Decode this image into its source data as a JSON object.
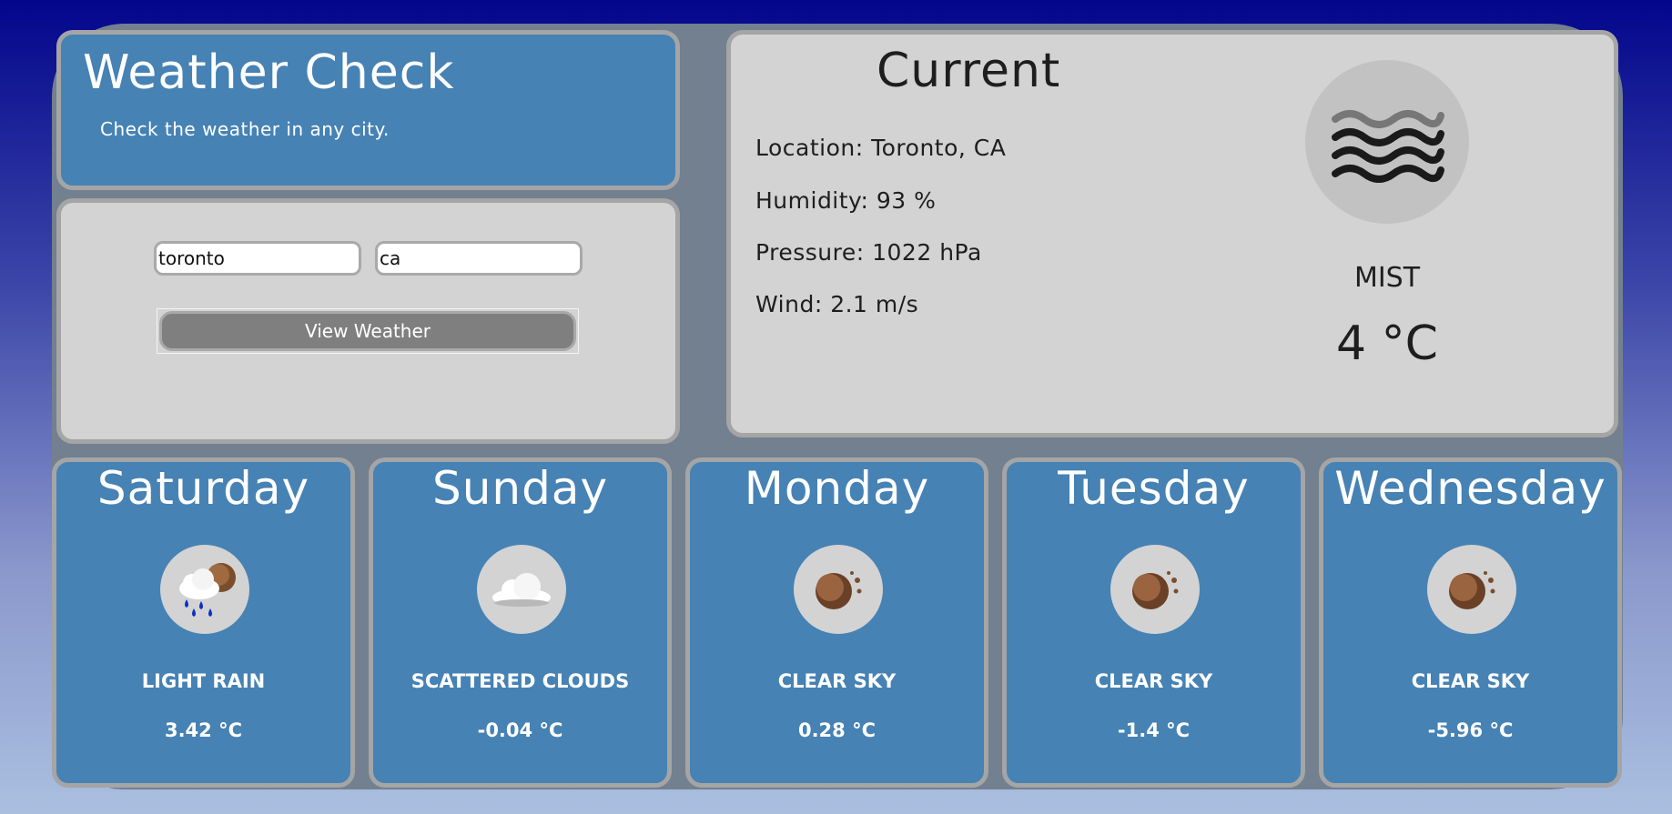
{
  "header": {
    "title": "Weather Check",
    "subtitle": "Check the weather in any city."
  },
  "form": {
    "city_value": "toronto",
    "country_value": "ca",
    "button_label": "View Weather"
  },
  "current": {
    "heading": "Current",
    "location": "Location: Toronto, CA",
    "humidity": "Humidity: 93 %",
    "pressure": "Pressure: 1022 hPa",
    "wind": "Wind: 2.1 m/s",
    "icon": "mist-icon",
    "description": "MIST",
    "temperature": "4 °C"
  },
  "forecast": [
    {
      "day": "Saturday",
      "icon": "rain-icon",
      "description": "LIGHT RAIN",
      "temperature": "3.42 °C"
    },
    {
      "day": "Sunday",
      "icon": "cloud-icon",
      "description": "SCATTERED CLOUDS",
      "temperature": "-0.04 °C"
    },
    {
      "day": "Monday",
      "icon": "clear-night-icon",
      "description": "CLEAR SKY",
      "temperature": "0.28 °C"
    },
    {
      "day": "Tuesday",
      "icon": "clear-night-icon",
      "description": "CLEAR SKY",
      "temperature": "-1.4 °C"
    },
    {
      "day": "Wednesday",
      "icon": "clear-night-icon",
      "description": "CLEAR SKY",
      "temperature": "-5.96 °C"
    }
  ],
  "colors": {
    "card_blue": "#4682b4",
    "card_grey": "#d3d3d3",
    "border": "#a5a5a5",
    "backdrop": "#72808f",
    "button": "#7f7f7f"
  }
}
